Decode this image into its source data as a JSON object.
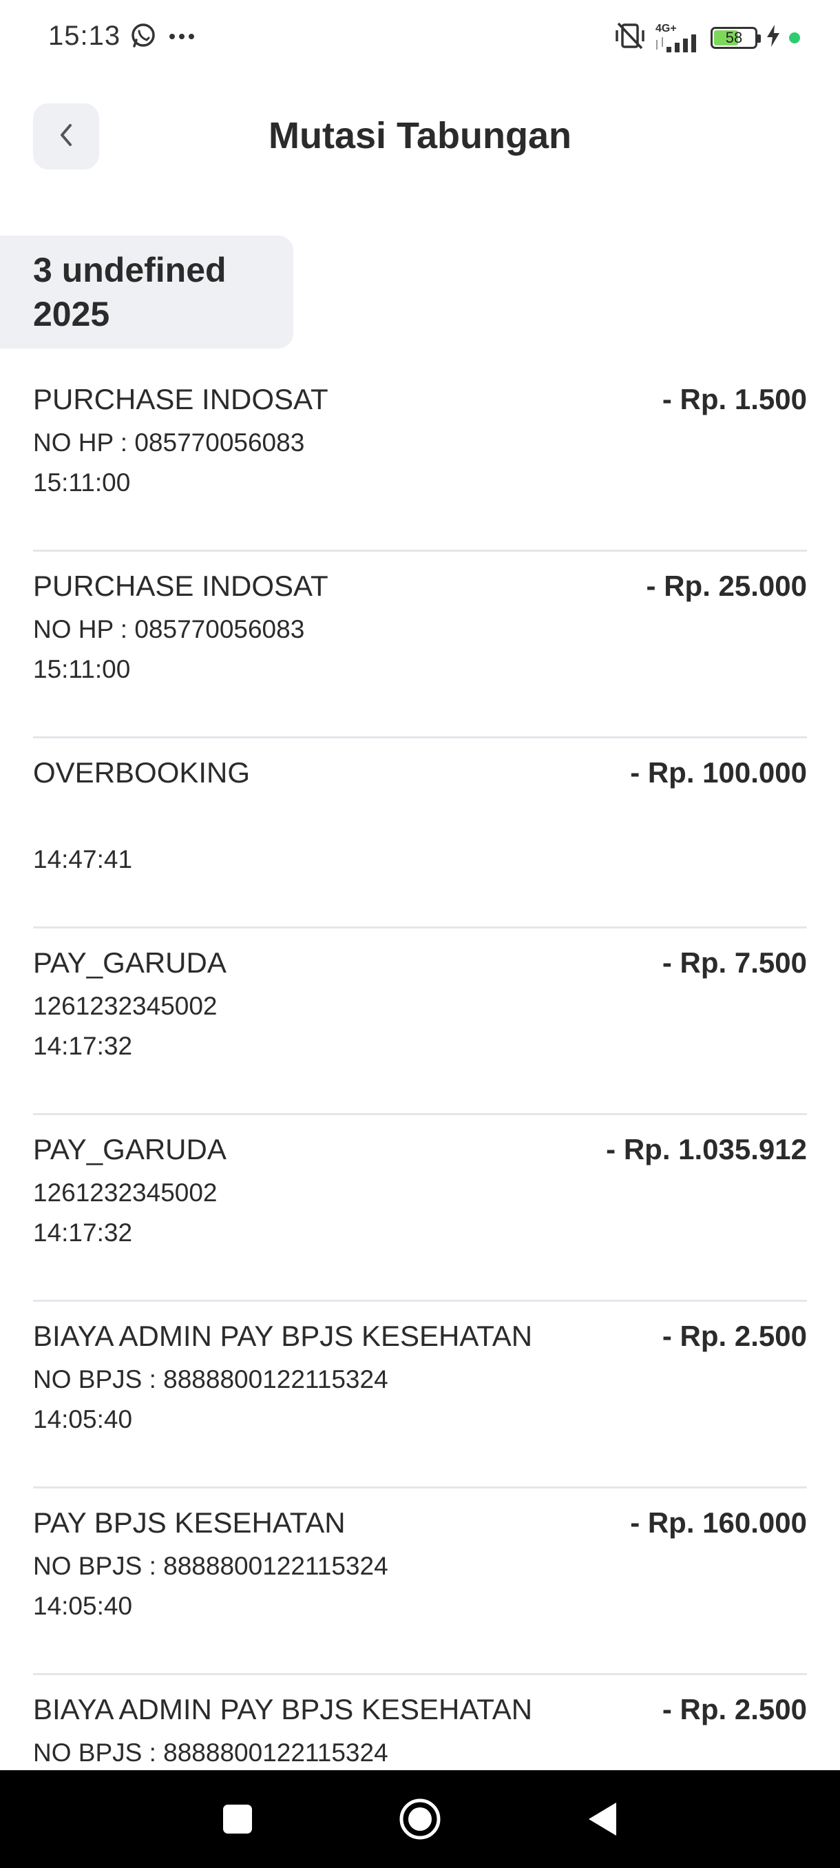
{
  "status_bar": {
    "time": "15:13",
    "battery_level": "58",
    "network": "4G+",
    "icons": [
      "whatsapp-icon",
      "more-dots-icon",
      "vibrate-off-icon",
      "signal-icon",
      "battery-icon",
      "charging-icon",
      "active-dot-icon"
    ]
  },
  "header": {
    "title": "Mutasi Tabungan",
    "back_icon": "chevron-left-icon"
  },
  "date_group": {
    "label_line1": "3 undefined",
    "label_line2": "2025"
  },
  "transactions": [
    {
      "title": "PURCHASE INDOSAT",
      "amount": "- Rp. 1.500",
      "detail": "NO HP : 085770056083",
      "time": "15:11:00"
    },
    {
      "title": "PURCHASE INDOSAT",
      "amount": "- Rp. 25.000",
      "detail": "NO HP : 085770056083",
      "time": "15:11:00"
    },
    {
      "title": "OVERBOOKING",
      "amount": "- Rp. 100.000",
      "detail": "",
      "time": "14:47:41"
    },
    {
      "title": "PAY_GARUDA",
      "amount": "- Rp. 7.500",
      "detail": "1261232345002",
      "time": "14:17:32"
    },
    {
      "title": "PAY_GARUDA",
      "amount": "- Rp. 1.035.912",
      "detail": "1261232345002",
      "time": "14:17:32"
    },
    {
      "title": "BIAYA ADMIN PAY BPJS KESEHATAN",
      "amount": "- Rp. 2.500",
      "detail": "NO BPJS : 8888800122115324",
      "time": "14:05:40"
    },
    {
      "title": "PAY BPJS KESEHATAN",
      "amount": "- Rp. 160.000",
      "detail": "NO BPJS : 8888800122115324",
      "time": "14:05:40"
    },
    {
      "title": "BIAYA ADMIN PAY BPJS KESEHATAN",
      "amount": "- Rp. 2.500",
      "detail": "NO BPJS : 8888800122115324",
      "time": ""
    }
  ],
  "nav_bar": {
    "icons": [
      "recents-square-icon",
      "home-circle-icon",
      "back-triangle-icon"
    ]
  },
  "colors": {
    "text": "#2b2b2b",
    "chip_bg": "#eef0f4",
    "divider": "#e4e6ec",
    "battery_fill": "#7dd85a",
    "active_dot": "#2ecc71"
  }
}
